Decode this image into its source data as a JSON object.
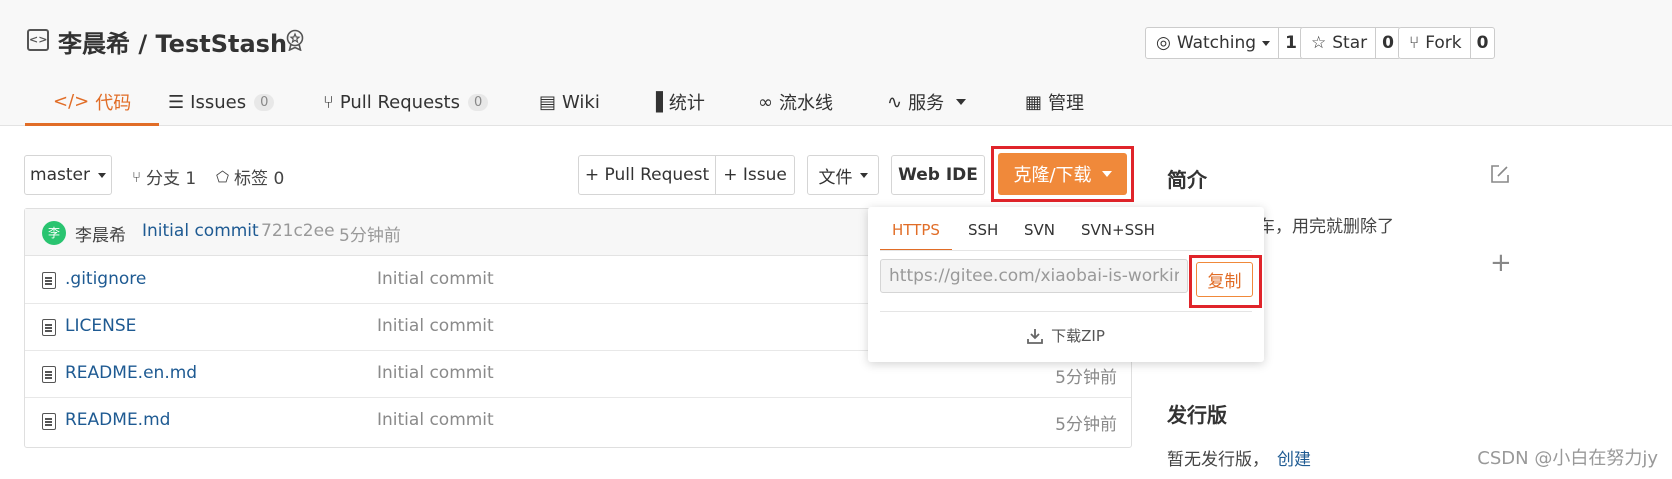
{
  "header": {
    "repo_owner": "李晨希",
    "separator": "/",
    "repo_name": "TestStash",
    "actions": [
      {
        "label": "Watching",
        "count": "1"
      },
      {
        "label": "Star",
        "count": "0"
      },
      {
        "label": "Fork",
        "count": "0"
      }
    ]
  },
  "tabs": [
    {
      "label": "代码",
      "active": true
    },
    {
      "label": "Issues",
      "count": "0"
    },
    {
      "label": "Pull Requests",
      "count": "0"
    },
    {
      "label": "Wiki"
    },
    {
      "label": "统计"
    },
    {
      "label": "流水线"
    },
    {
      "label": "服务"
    },
    {
      "label": "管理"
    }
  ],
  "toolbar": {
    "branch": "master",
    "branches_label": "分支 1",
    "tags_label": "标签 0",
    "pull_request": "+ Pull Request",
    "issue": "+ Issue",
    "file": "文件",
    "web_ide": "Web IDE",
    "clone": "克隆/下载"
  },
  "commit": {
    "avatar": "李",
    "author": "李晨希",
    "message": "Initial commit",
    "hash": "721c2ee",
    "time": "5分钟前"
  },
  "files": [
    {
      "name": ".gitignore",
      "message": "Initial commit",
      "time": ""
    },
    {
      "name": "LICENSE",
      "message": "Initial commit",
      "time": ""
    },
    {
      "name": "README.en.md",
      "message": "Initial commit",
      "time": "5分钟前"
    },
    {
      "name": "README.md",
      "message": "Initial commit",
      "time": "5分钟前"
    }
  ],
  "clone_dropdown": {
    "protocols": [
      "HTTPS",
      "SSH",
      "SVN",
      "SVN+SSH"
    ],
    "active_protocol": "HTTPS",
    "url": "https://gitee.com/xiaobai-is-working-h",
    "copy": "复制",
    "download_zip": "下载ZIP"
  },
  "sidebar": {
    "intro_heading": "简介",
    "intro_text": "车，用完就删除了",
    "releases_heading": "发行版",
    "releases_text": "暂无发行版，",
    "create_link": "创建"
  },
  "watermark": "CSDN @小白在努力jy",
  "colors": {
    "accent": "#e16d27",
    "clone_button": "#f0893a",
    "highlight": "#e0242a",
    "link": "#1e5a92"
  }
}
